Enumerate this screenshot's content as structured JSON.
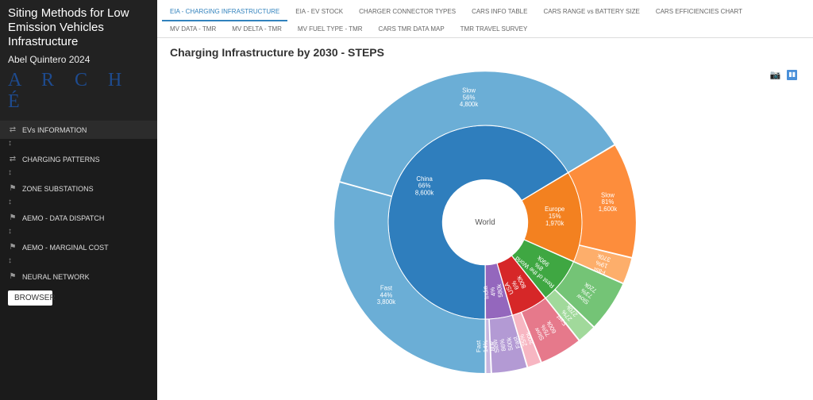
{
  "sidebar": {
    "title": "Siting Methods for Low Emission Vehicles Infrastructure",
    "byline": "Abel Quintero 2024",
    "logo": "A R C H É",
    "items": [
      {
        "icon": "⇄",
        "label": "EVs INFORMATION"
      },
      {
        "icon": "⇄",
        "label": "CHARGING PATTERNS"
      },
      {
        "icon": "⚑",
        "label": "ZONE SUBSTATIONS"
      },
      {
        "icon": "⚑",
        "label": "AEMO - DATA DISPATCH"
      },
      {
        "icon": "⚑",
        "label": "AEMO - MARGINAL COST"
      },
      {
        "icon": "⚑",
        "label": "NEURAL NETWORK"
      }
    ],
    "browser": "BROWSER"
  },
  "tabs": {
    "items": [
      "EIA - CHARGING INFRASTRUCTURE",
      "EIA - EV STOCK",
      "CHARGER CONNECTOR TYPES",
      "CARS INFO TABLE",
      "CARS RANGE vs BATTERY SIZE",
      "CARS EFFICIENCIES CHART",
      "MV DATA - TMR",
      "MV DELTA - TMR",
      "MV FUEL TYPE - TMR",
      "CARS TMR DATA MAP",
      "TMR TRAVEL SURVEY"
    ],
    "active": 0
  },
  "chart": {
    "title": "Charging Infrastructure by 2030 - STEPS",
    "center": "World"
  },
  "labels": {
    "china": {
      "l1": "China",
      "l2": "66%",
      "l3": "8,600k"
    },
    "china_fast": {
      "l1": "Fast",
      "l2": "44%",
      "l3": "3,800k"
    },
    "china_slow": {
      "l1": "Slow",
      "l2": "56%",
      "l3": "4,800k"
    },
    "europe": {
      "l1": "Europe",
      "l2": "15%",
      "l3": "1,970k"
    },
    "europe_slow": {
      "l1": "Slow",
      "l2": "81%",
      "l3": "1,600k"
    },
    "europe_fast": {
      "l1": "Fast",
      "l2": "19%",
      "l3": "370k"
    },
    "row": {
      "l1": "Rest of the World",
      "l2": "8%",
      "l3": "990k"
    },
    "row_slow": {
      "l1": "Slow",
      "l2": "73%",
      "l3": "720k"
    },
    "row_fast": {
      "l1": "Fast",
      "l2": "27%",
      "l3": "270k"
    },
    "usa": {
      "l1": "USA",
      "l2": "6%",
      "l3": "800k"
    },
    "usa_slow": {
      "l1": "Slow",
      "l2": "75%",
      "l3": "600k"
    },
    "usa_fast": {
      "l1": "Fast",
      "l2": "25%",
      "l3": "200k"
    },
    "india": {
      "l1": "India",
      "l2": "4%",
      "l3": "580k"
    },
    "india_slow": {
      "l1": "Slow",
      "l2": "86%",
      "l3": "500k"
    },
    "india_fast": {
      "l1": "Fast",
      "l2": "14%",
      "l3": "80k"
    }
  },
  "chart_data": {
    "type": "pie",
    "title": "Charging Infrastructure by 2030 - STEPS",
    "unit": "thousand chargers (k)",
    "root": "World",
    "inner_ring": [
      {
        "name": "China",
        "pct": 66,
        "value_k": 8600,
        "color": "#2f7ebd"
      },
      {
        "name": "Europe",
        "pct": 15,
        "value_k": 1970,
        "color": "#f38120"
      },
      {
        "name": "Rest of the World",
        "pct": 8,
        "value_k": 990,
        "color": "#3fa742"
      },
      {
        "name": "USA",
        "pct": 6,
        "value_k": 800,
        "color": "#d62728"
      },
      {
        "name": "India",
        "pct": 4,
        "value_k": 580,
        "color": "#9467bd"
      }
    ],
    "outer_ring": [
      {
        "parent": "China",
        "name": "Fast",
        "pct_of_parent": 44,
        "value_k": 3800,
        "color": "#6baed6"
      },
      {
        "parent": "China",
        "name": "Slow",
        "pct_of_parent": 56,
        "value_k": 4800,
        "color": "#6baed6"
      },
      {
        "parent": "Europe",
        "name": "Slow",
        "pct_of_parent": 81,
        "value_k": 1600,
        "color": "#fd8d3c"
      },
      {
        "parent": "Europe",
        "name": "Fast",
        "pct_of_parent": 19,
        "value_k": 370,
        "color": "#fdae6b"
      },
      {
        "parent": "Rest of the World",
        "name": "Slow",
        "pct_of_parent": 73,
        "value_k": 720,
        "color": "#74c476"
      },
      {
        "parent": "Rest of the World",
        "name": "Fast",
        "pct_of_parent": 27,
        "value_k": 270,
        "color": "#a1d99b"
      },
      {
        "parent": "USA",
        "name": "Slow",
        "pct_of_parent": 75,
        "value_k": 600,
        "color": "#e6798b"
      },
      {
        "parent": "USA",
        "name": "Fast",
        "pct_of_parent": 25,
        "value_k": 200,
        "color": "#f7b6c2"
      },
      {
        "parent": "India",
        "name": "Slow",
        "pct_of_parent": 86,
        "value_k": 500,
        "color": "#b39ad4"
      },
      {
        "parent": "India",
        "name": "Fast",
        "pct_of_parent": 14,
        "value_k": 80,
        "color": "#c7b6df"
      }
    ]
  }
}
